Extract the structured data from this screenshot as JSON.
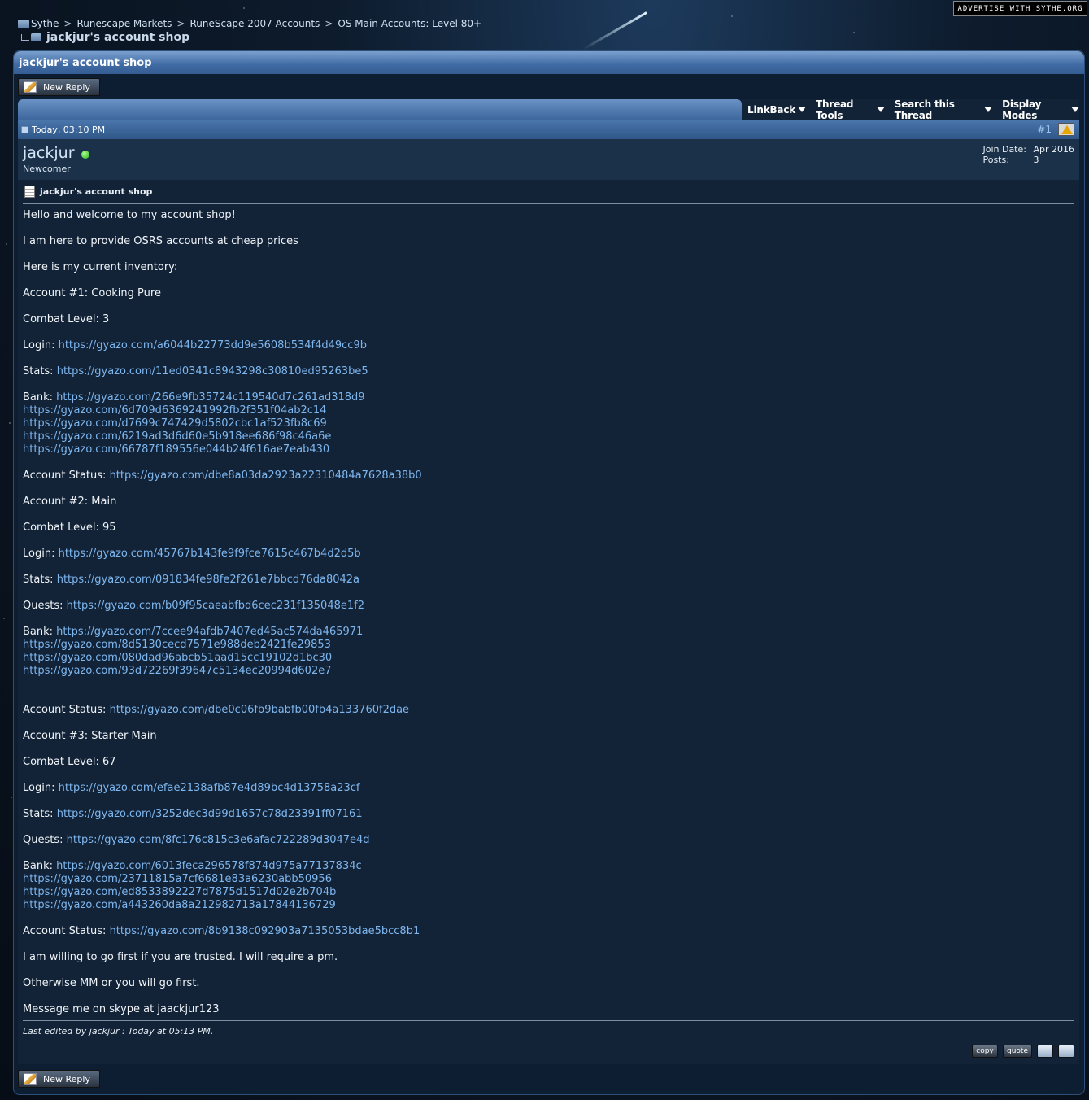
{
  "ad": "ADVERTISE WITH SYTHE.ORG",
  "breadcrumb": {
    "items": [
      "Sythe",
      "Runescape Markets",
      "RuneScape 2007 Accounts",
      "OS Main Accounts: Level 80+"
    ],
    "separator": ">",
    "current": "jackjur's account shop"
  },
  "thread": {
    "title": "jackjur's account shop"
  },
  "buttons": {
    "new_reply": "New Reply"
  },
  "tools": {
    "linkback": "LinkBack",
    "thread_tools": "Thread Tools",
    "search": "Search this Thread",
    "display": "Display Modes"
  },
  "post": {
    "date": "Today, 03:10 PM",
    "number": "#1",
    "username": "jackjur",
    "usertitle": "Newcomer",
    "join_label": "Join Date:",
    "join_value": "Apr 2016",
    "posts_label": "Posts:",
    "posts_value": "3",
    "title": "jackjur's account shop",
    "edited": "Last edited by jackjur : Today at 05:13 PM.",
    "copy": "copy",
    "quote": "quote",
    "lines": [
      {
        "t": "Hello and welcome to my account shop!"
      },
      {
        "t": ""
      },
      {
        "t": "I am here to provide OSRS accounts at cheap prices"
      },
      {
        "t": ""
      },
      {
        "t": "Here is my current inventory:"
      },
      {
        "t": ""
      },
      {
        "t": "Account #1: Cooking Pure"
      },
      {
        "t": ""
      },
      {
        "t": "Combat Level: 3"
      },
      {
        "t": ""
      },
      {
        "t": "Login: ",
        "l": "https://gyazo.com/a6044b22773dd9e5608b534f4d49cc9b"
      },
      {
        "t": ""
      },
      {
        "t": "Stats: ",
        "l": "https://gyazo.com/11ed0341c8943298c30810ed95263be5"
      },
      {
        "t": ""
      },
      {
        "t": "Bank: ",
        "l": "https://gyazo.com/266e9fb35724c119540d7c261ad318d9"
      },
      {
        "t": "",
        "l": "https://gyazo.com/6d709d6369241992fb2f351f04ab2c14"
      },
      {
        "t": "",
        "l": "https://gyazo.com/d7699c747429d5802cbc1af523fb8c69"
      },
      {
        "t": "",
        "l": "https://gyazo.com/6219ad3d6d60e5b918ee686f98c46a6e"
      },
      {
        "t": "",
        "l": "https://gyazo.com/66787f189556e044b24f616ae7eab430"
      },
      {
        "t": ""
      },
      {
        "t": "Account Status: ",
        "l": "https://gyazo.com/dbe8a03da2923a22310484a7628a38b0"
      },
      {
        "t": ""
      },
      {
        "t": "Account #2: Main"
      },
      {
        "t": ""
      },
      {
        "t": "Combat Level: 95"
      },
      {
        "t": ""
      },
      {
        "t": "Login: ",
        "l": "https://gyazo.com/45767b143fe9f9fce7615c467b4d2d5b"
      },
      {
        "t": ""
      },
      {
        "t": "Stats: ",
        "l": "https://gyazo.com/091834fe98fe2f261e7bbcd76da8042a"
      },
      {
        "t": ""
      },
      {
        "t": "Quests: ",
        "l": "https://gyazo.com/b09f95caeabfbd6cec231f135048e1f2"
      },
      {
        "t": ""
      },
      {
        "t": "Bank: ",
        "l": "https://gyazo.com/7ccee94afdb7407ed45ac574da465971"
      },
      {
        "t": "",
        "l": "https://gyazo.com/8d5130cecd7571e988deb2421fe29853"
      },
      {
        "t": "",
        "l": "https://gyazo.com/080dad96abcb51aad15cc19102d1bc30"
      },
      {
        "t": "",
        "l": "https://gyazo.com/93d72269f39647c5134ec20994d602e7"
      },
      {
        "t": ""
      },
      {
        "t": ""
      },
      {
        "t": "Account Status: ",
        "l": "https://gyazo.com/dbe0c06fb9babfb00fb4a133760f2dae"
      },
      {
        "t": ""
      },
      {
        "t": "Account #3: Starter Main"
      },
      {
        "t": ""
      },
      {
        "t": "Combat Level: 67"
      },
      {
        "t": ""
      },
      {
        "t": "Login: ",
        "l": "https://gyazo.com/efae2138afb87e4d89bc4d13758a23cf"
      },
      {
        "t": ""
      },
      {
        "t": "Stats: ",
        "l": "https://gyazo.com/3252dec3d99d1657c78d23391ff07161"
      },
      {
        "t": ""
      },
      {
        "t": "Quests: ",
        "l": "https://gyazo.com/8fc176c815c3e6afac722289d3047e4d"
      },
      {
        "t": ""
      },
      {
        "t": "Bank: ",
        "l": "https://gyazo.com/6013feca296578f874d975a77137834c"
      },
      {
        "t": "",
        "l": "https://gyazo.com/23711815a7cf6681e83a6230abb50956"
      },
      {
        "t": "",
        "l": "https://gyazo.com/ed8533892227d7875d1517d02e2b704b"
      },
      {
        "t": "",
        "l": "https://gyazo.com/a443260da8a212982713a17844136729"
      },
      {
        "t": ""
      },
      {
        "t": "Account Status: ",
        "l": "https://gyazo.com/8b9138c092903a7135053bdae5bcc8b1"
      },
      {
        "t": ""
      },
      {
        "t": "I am willing to go first if you are trusted. I will require a pm."
      },
      {
        "t": ""
      },
      {
        "t": "Otherwise MM or you will go first."
      },
      {
        "t": ""
      },
      {
        "t": "Message me on skype at jaackjur123"
      }
    ]
  }
}
